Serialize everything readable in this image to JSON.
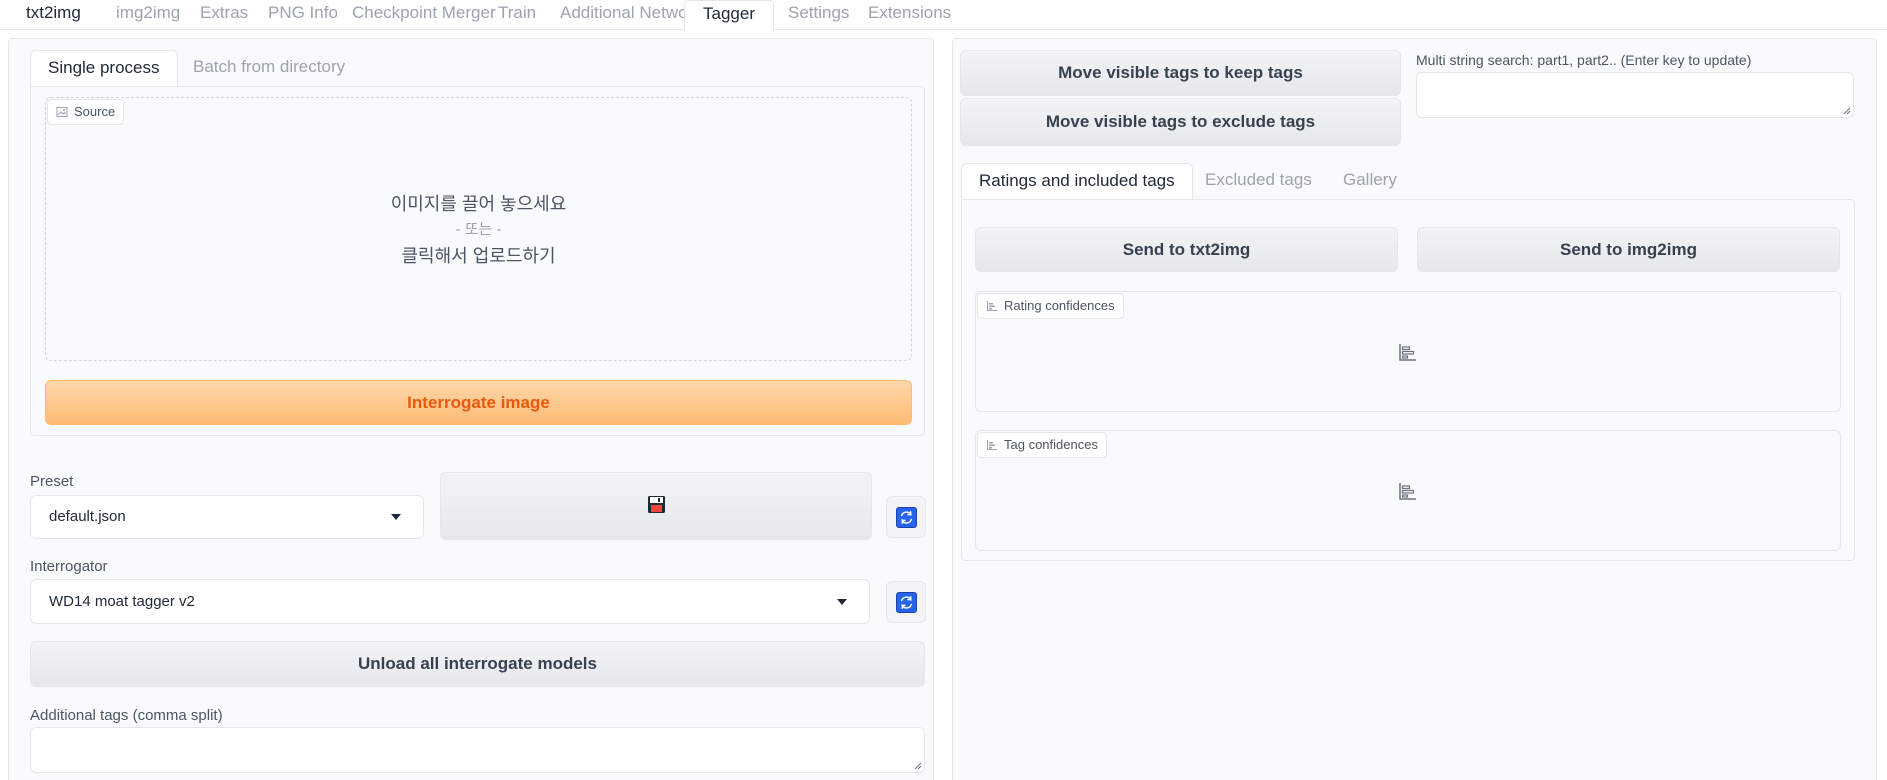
{
  "top_tabs": [
    {
      "label": "txt2img"
    },
    {
      "label": "img2img"
    },
    {
      "label": "Extras"
    },
    {
      "label": "PNG Info"
    },
    {
      "label": "Checkpoint Merger"
    },
    {
      "label": "Train"
    },
    {
      "label": "Additional Networks"
    },
    {
      "label": "Tagger",
      "active": true
    },
    {
      "label": "Settings"
    },
    {
      "label": "Extensions"
    }
  ],
  "left": {
    "sub_tabs": [
      {
        "label": "Single process",
        "active": true
      },
      {
        "label": "Batch from directory"
      }
    ],
    "source": {
      "label": "Source",
      "drop_text": "이미지를 끌어 놓으세요",
      "or_text": "- 또는 -",
      "click_text": "클릭해서 업로드하기"
    },
    "interrogate_button": "Interrogate image",
    "preset": {
      "label": "Preset",
      "value": "default.json",
      "save_icon": "floppy-disk-icon",
      "refresh_icon": "refresh-icon"
    },
    "interrogator": {
      "label": "Interrogator",
      "value": "WD14 moat tagger v2",
      "refresh_icon": "refresh-icon"
    },
    "unload_button": "Unload all interrogate models",
    "additional_tags": {
      "label": "Additional tags (comma split)",
      "value": ""
    }
  },
  "right": {
    "keep_button": "Move visible tags to keep tags",
    "exclude_button": "Move visible tags to exclude tags",
    "search": {
      "label": "Multi string search: part1, part2.. (Enter key to update)",
      "value": ""
    },
    "result_tabs": [
      {
        "label": "Ratings and included tags",
        "active": true
      },
      {
        "label": "Excluded tags"
      },
      {
        "label": "Gallery"
      }
    ],
    "send_txt2img": "Send to txt2img",
    "send_img2img": "Send to img2img",
    "rating_label": "Rating confidences",
    "tag_label": "Tag confidences"
  },
  "colors": {
    "accent_orange": "#ea580c",
    "refresh_blue": "#2563eb"
  }
}
